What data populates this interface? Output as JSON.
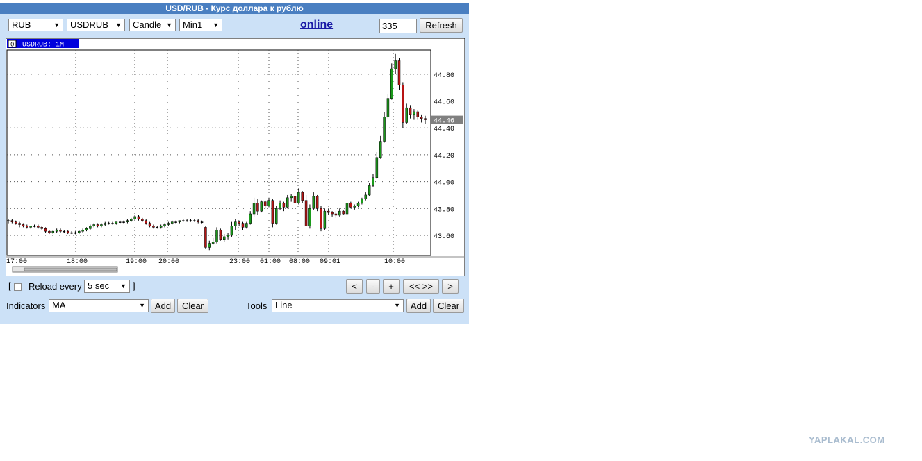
{
  "title": "USD/RUB - Курс доллара к рублю",
  "toolbar": {
    "currency": "RUB",
    "symbol": "USDRUB",
    "chart_type": "Candle",
    "interval": "Min1",
    "online_label": "online",
    "period_value": "335",
    "refresh_label": "Refresh"
  },
  "chart": {
    "header_badge": "0",
    "header_label": "USDRUB: 1M",
    "current_price_label": "44.46"
  },
  "chart_data": {
    "type": "candlestick",
    "title": "USDRUB: 1M",
    "xlabel": "",
    "ylabel": "",
    "ylim": [
      43.45,
      44.98
    ],
    "y_ticks": [
      "43.60",
      "43.80",
      "44.00",
      "44.20",
      "44.40",
      "44.60",
      "44.80"
    ],
    "x_ticks": [
      "17:00",
      "18:00",
      "19:00",
      "20:00",
      "23:00",
      "01:00",
      "08:00",
      "09:01",
      "10:00"
    ],
    "current_price": 44.46,
    "grid": true,
    "colors": {
      "up": "#1a9a1a",
      "down": "#b81414",
      "flat": "#000000",
      "price_tag": "#808080"
    },
    "candles": [
      [
        43.71,
        43.72,
        43.69,
        43.71
      ],
      [
        43.71,
        43.72,
        43.69,
        43.7
      ],
      [
        43.7,
        43.71,
        43.68,
        43.69
      ],
      [
        43.69,
        43.7,
        43.66,
        43.68
      ],
      [
        43.68,
        43.69,
        43.66,
        43.67
      ],
      [
        43.67,
        43.68,
        43.65,
        43.66
      ],
      [
        43.66,
        43.67,
        43.65,
        43.67
      ],
      [
        43.67,
        43.68,
        43.66,
        43.67
      ],
      [
        43.67,
        43.68,
        43.65,
        43.66
      ],
      [
        43.66,
        43.67,
        43.64,
        43.65
      ],
      [
        43.65,
        43.66,
        43.62,
        43.63
      ],
      [
        43.63,
        43.64,
        43.61,
        43.62
      ],
      [
        43.62,
        43.64,
        43.61,
        43.63
      ],
      [
        43.63,
        43.65,
        43.62,
        43.64
      ],
      [
        43.64,
        43.65,
        43.62,
        43.63
      ],
      [
        43.63,
        43.64,
        43.62,
        43.63
      ],
      [
        43.63,
        43.64,
        43.61,
        43.62
      ],
      [
        43.62,
        43.63,
        43.61,
        43.62
      ],
      [
        43.62,
        43.63,
        43.61,
        43.62
      ],
      [
        43.62,
        43.64,
        43.61,
        43.63
      ],
      [
        43.63,
        43.65,
        43.62,
        43.64
      ],
      [
        43.64,
        43.66,
        43.63,
        43.65
      ],
      [
        43.65,
        43.68,
        43.64,
        43.67
      ],
      [
        43.67,
        43.69,
        43.66,
        43.68
      ],
      [
        43.68,
        43.69,
        43.66,
        43.67
      ],
      [
        43.67,
        43.69,
        43.66,
        43.68
      ],
      [
        43.68,
        43.7,
        43.67,
        43.69
      ],
      [
        43.69,
        43.7,
        43.68,
        43.69
      ],
      [
        43.69,
        43.7,
        43.68,
        43.69
      ],
      [
        43.69,
        43.7,
        43.68,
        43.7
      ],
      [
        43.7,
        43.71,
        43.69,
        43.7
      ],
      [
        43.7,
        43.71,
        43.69,
        43.7
      ],
      [
        43.7,
        43.72,
        43.69,
        43.71
      ],
      [
        43.71,
        43.73,
        43.7,
        43.72
      ],
      [
        43.72,
        43.75,
        43.71,
        43.74
      ],
      [
        43.74,
        43.75,
        43.71,
        43.72
      ],
      [
        43.72,
        43.73,
        43.7,
        43.71
      ],
      [
        43.71,
        43.72,
        43.68,
        43.69
      ],
      [
        43.69,
        43.7,
        43.66,
        43.67
      ],
      [
        43.67,
        43.68,
        43.65,
        43.66
      ],
      [
        43.66,
        43.67,
        43.65,
        43.66
      ],
      [
        43.66,
        43.68,
        43.65,
        43.67
      ],
      [
        43.67,
        43.69,
        43.66,
        43.68
      ],
      [
        43.68,
        43.7,
        43.67,
        43.69
      ],
      [
        43.69,
        43.71,
        43.68,
        43.7
      ],
      [
        43.7,
        43.71,
        43.69,
        43.7
      ],
      [
        43.7,
        43.71,
        43.69,
        43.71
      ],
      [
        43.71,
        43.72,
        43.7,
        43.71
      ],
      [
        43.71,
        43.72,
        43.7,
        43.71
      ],
      [
        43.71,
        43.72,
        43.7,
        43.71
      ],
      [
        43.71,
        43.72,
        43.7,
        43.71
      ],
      [
        43.71,
        43.72,
        43.69,
        43.7
      ],
      [
        43.7,
        43.71,
        43.69,
        43.7
      ],
      [
        43.66,
        43.67,
        43.5,
        43.51
      ],
      [
        43.51,
        43.56,
        43.49,
        43.54
      ],
      [
        43.54,
        43.58,
        43.53,
        43.55
      ],
      [
        43.55,
        43.66,
        43.54,
        43.64
      ],
      [
        43.64,
        43.65,
        43.56,
        43.57
      ],
      [
        43.57,
        43.61,
        43.55,
        43.59
      ],
      [
        43.59,
        43.62,
        43.57,
        43.6
      ],
      [
        43.6,
        43.7,
        43.59,
        43.67
      ],
      [
        43.67,
        43.72,
        43.64,
        43.7
      ],
      [
        43.7,
        43.71,
        43.67,
        43.69
      ],
      [
        43.69,
        43.7,
        43.64,
        43.66
      ],
      [
        43.66,
        43.7,
        43.65,
        43.69
      ],
      [
        43.69,
        43.78,
        43.68,
        43.76
      ],
      [
        43.76,
        43.88,
        43.74,
        43.84
      ],
      [
        43.84,
        43.87,
        43.75,
        43.78
      ],
      [
        43.78,
        43.86,
        43.77,
        43.85
      ],
      [
        43.85,
        43.86,
        43.8,
        43.82
      ],
      [
        43.82,
        43.88,
        43.81,
        43.86
      ],
      [
        43.86,
        43.87,
        43.66,
        43.69
      ],
      [
        43.69,
        43.82,
        43.68,
        43.8
      ],
      [
        43.8,
        43.86,
        43.79,
        43.84
      ],
      [
        43.84,
        43.85,
        43.78,
        43.81
      ],
      [
        43.81,
        43.9,
        43.8,
        43.88
      ],
      [
        43.88,
        43.91,
        43.85,
        43.89
      ],
      [
        43.89,
        43.9,
        43.82,
        43.84
      ],
      [
        43.84,
        43.95,
        43.83,
        43.92
      ],
      [
        43.92,
        43.93,
        43.84,
        43.86
      ],
      [
        43.86,
        43.9,
        43.7,
        43.67
      ],
      [
        43.67,
        43.83,
        43.65,
        43.8
      ],
      [
        43.8,
        43.92,
        43.79,
        43.89
      ],
      [
        43.89,
        43.9,
        43.78,
        43.8
      ],
      [
        43.8,
        43.82,
        43.63,
        43.65
      ],
      [
        43.65,
        43.8,
        43.64,
        43.78
      ],
      [
        43.78,
        43.8,
        43.75,
        43.77
      ],
      [
        43.77,
        43.78,
        43.74,
        43.76
      ],
      [
        43.76,
        43.78,
        43.73,
        43.75
      ],
      [
        43.75,
        43.8,
        43.74,
        43.78
      ],
      [
        43.78,
        43.79,
        43.75,
        43.76
      ],
      [
        43.76,
        43.86,
        43.75,
        43.84
      ],
      [
        43.84,
        43.85,
        43.8,
        43.81
      ],
      [
        43.81,
        43.83,
        43.79,
        43.82
      ],
      [
        43.82,
        43.85,
        43.81,
        43.84
      ],
      [
        43.84,
        43.88,
        43.83,
        43.87
      ],
      [
        43.87,
        43.92,
        43.86,
        43.9
      ],
      [
        43.9,
        43.99,
        43.89,
        43.97
      ],
      [
        43.97,
        44.06,
        43.96,
        44.03
      ],
      [
        44.03,
        44.22,
        44.02,
        44.18
      ],
      [
        44.18,
        44.34,
        44.17,
        44.3
      ],
      [
        44.3,
        44.52,
        44.29,
        44.48
      ],
      [
        44.48,
        44.65,
        44.47,
        44.62
      ],
      [
        44.62,
        44.88,
        44.61,
        44.84
      ],
      [
        44.84,
        44.95,
        44.8,
        44.9
      ],
      [
        44.9,
        44.92,
        44.68,
        44.72
      ],
      [
        44.72,
        44.74,
        44.4,
        44.44
      ],
      [
        44.44,
        44.58,
        44.43,
        44.55
      ],
      [
        44.55,
        44.57,
        44.47,
        44.5
      ],
      [
        44.5,
        44.54,
        44.46,
        44.52
      ],
      [
        44.52,
        44.53,
        44.46,
        44.48
      ],
      [
        44.48,
        44.5,
        44.44,
        44.47
      ],
      [
        44.47,
        44.49,
        44.43,
        44.46
      ]
    ]
  },
  "controls": {
    "bracket_open": "[",
    "reload_label": "Reload every",
    "reload_interval": "5 sec",
    "bracket_close": "]",
    "nav_prev": "<",
    "nav_zoom_out": "-",
    "nav_zoom_in": "+",
    "nav_fit": "<< >>",
    "nav_next": ">",
    "indicators_label": "Indicators",
    "indicator_value": "MA",
    "indicator_add": "Add",
    "indicator_clear": "Clear",
    "tools_label": "Tools",
    "tool_value": "Line",
    "tool_add": "Add",
    "tool_clear": "Clear"
  },
  "watermark": "YAPLAKAL.COM"
}
